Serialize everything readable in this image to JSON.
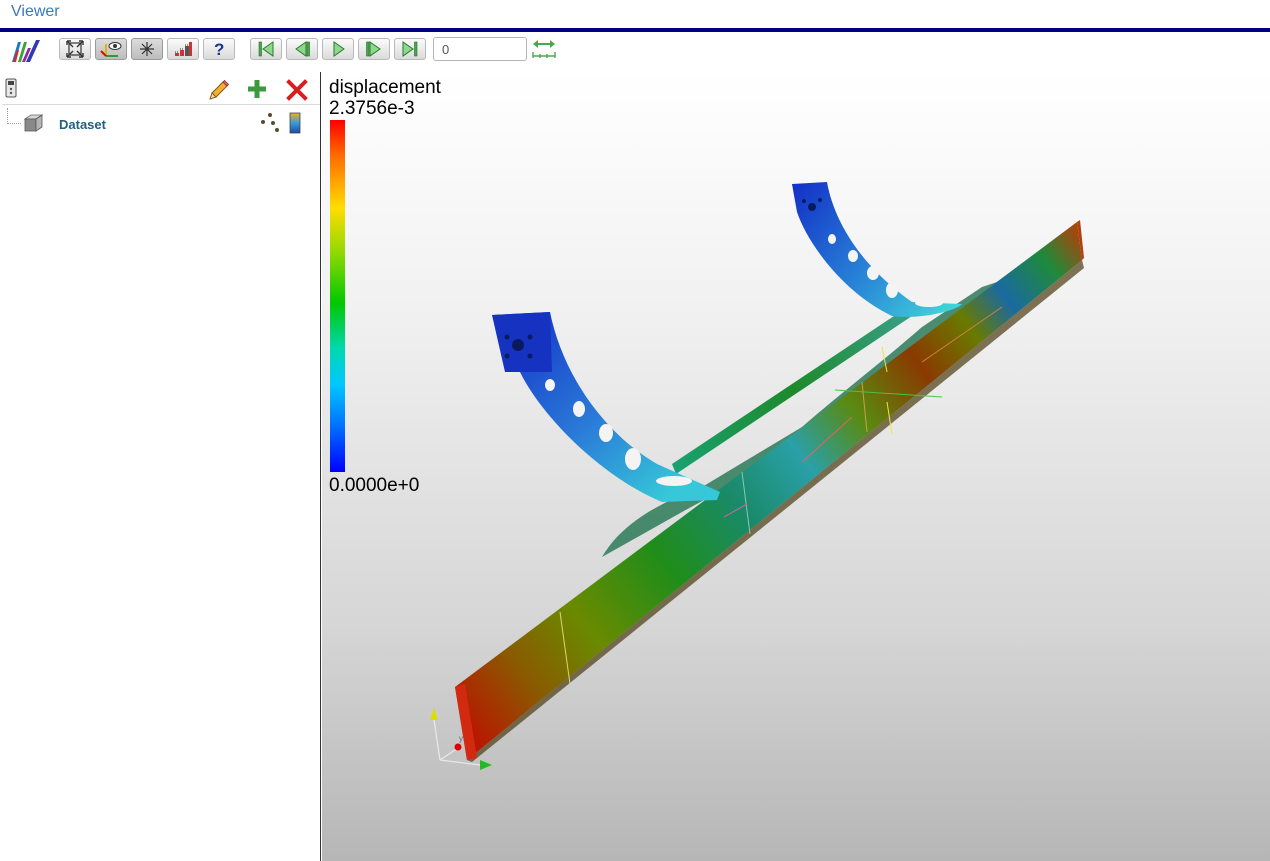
{
  "app": {
    "title": "Viewer"
  },
  "toolbar": {
    "buttons": [
      {
        "name": "reset-camera",
        "icon": "expand-arrows-icon"
      },
      {
        "name": "toggle-orientation-axes",
        "icon": "eye-axes-icon",
        "active": true
      },
      {
        "name": "toggle-center-axes",
        "icon": "asterisk-icon",
        "active": true
      },
      {
        "name": "toggle-statistics",
        "icon": "histogram-icon"
      },
      {
        "name": "help",
        "icon": "question-icon"
      },
      {
        "name": "first-frame",
        "icon": "skip-first-icon"
      },
      {
        "name": "previous-frame",
        "icon": "step-back-icon"
      },
      {
        "name": "play",
        "icon": "play-icon"
      },
      {
        "name": "next-frame",
        "icon": "step-forward-icon"
      },
      {
        "name": "last-frame",
        "icon": "skip-last-icon"
      }
    ],
    "frame_value": "0"
  },
  "panel": {
    "tools": {
      "remote_icon": "remote-control-icon",
      "edit_icon": "pencil-icon",
      "add_icon": "plus-icon",
      "delete_icon": "delete-x-icon"
    },
    "tree": [
      {
        "label": "Dataset",
        "icon": "cube-icon",
        "representation_icon": "points-icon",
        "color_icon": "color-legend-icon"
      }
    ]
  },
  "viewport": {
    "colorbar": {
      "title": "displacement",
      "max_label": "2.3756e-3",
      "min_label": "0.0000e+0",
      "colors": [
        "#ff0000",
        "#ffdd00",
        "#00c800",
        "#00c8ff",
        "#0000ff"
      ]
    },
    "orientation_axes": {
      "x_color": "#22bb22",
      "y_color": "#dddd00",
      "z_color": "#dd0000",
      "y_label": "y"
    }
  },
  "colors": {
    "title_text": "#3a7bb5",
    "header_bar": "#000088",
    "tree_label": "#22607f"
  }
}
